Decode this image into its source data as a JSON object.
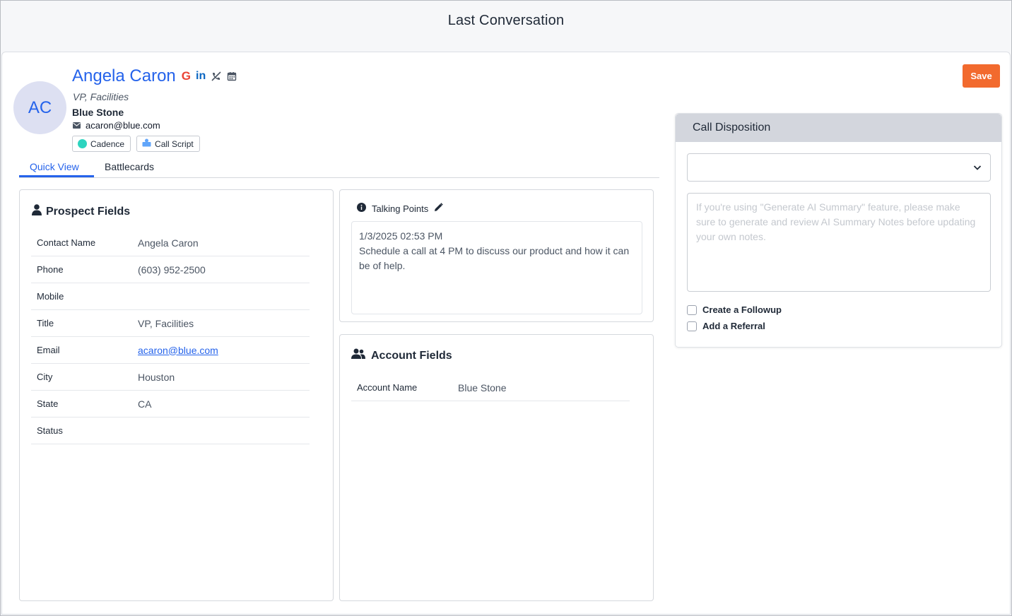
{
  "window": {
    "title": "Last Conversation"
  },
  "contact": {
    "initials": "AC",
    "name": "Angela Caron",
    "title": "VP, Facilities",
    "company": "Blue Stone",
    "email": "acaron@blue.com",
    "google_glyph": "G",
    "linkedin_glyph": "in"
  },
  "header_buttons": {
    "cadence": "Cadence",
    "call_script": "Call Script",
    "save": "Save"
  },
  "tabs": [
    {
      "label": "Quick View",
      "active": true
    },
    {
      "label": "Battlecards",
      "active": false
    }
  ],
  "prospect_fields": {
    "heading": "Prospect Fields",
    "rows": [
      {
        "label": "Contact Name",
        "value": "Angela Caron"
      },
      {
        "label": "Phone",
        "value": "(603) 952-2500"
      },
      {
        "label": "Mobile",
        "value": ""
      },
      {
        "label": "Title",
        "value": "VP, Facilities"
      },
      {
        "label": "Email",
        "value": "acaron@blue.com"
      },
      {
        "label": "City",
        "value": "Houston"
      },
      {
        "label": "State",
        "value": "CA"
      },
      {
        "label": "Status",
        "value": ""
      }
    ]
  },
  "talking_points": {
    "heading": "Talking Points",
    "timestamp": "1/3/2025 02:53 PM",
    "note": "Schedule a call at 4 PM to discuss our product and how it can be of help."
  },
  "account_fields": {
    "heading": "Account Fields",
    "rows": [
      {
        "label": "Account Name",
        "value": "Blue Stone"
      }
    ]
  },
  "call_disposition": {
    "heading": "Call Disposition",
    "selected": "",
    "notes_placeholder": "If you're using \"Generate AI Summary\" feature, please make sure to generate and review AI Summary Notes before updating your own notes.",
    "create_followup": "Create a Followup",
    "add_referral": "Add a Referral"
  },
  "colors": {
    "accent": "#2563eb",
    "save": "#f26a2e",
    "header_bg": "#d3d6dd"
  }
}
